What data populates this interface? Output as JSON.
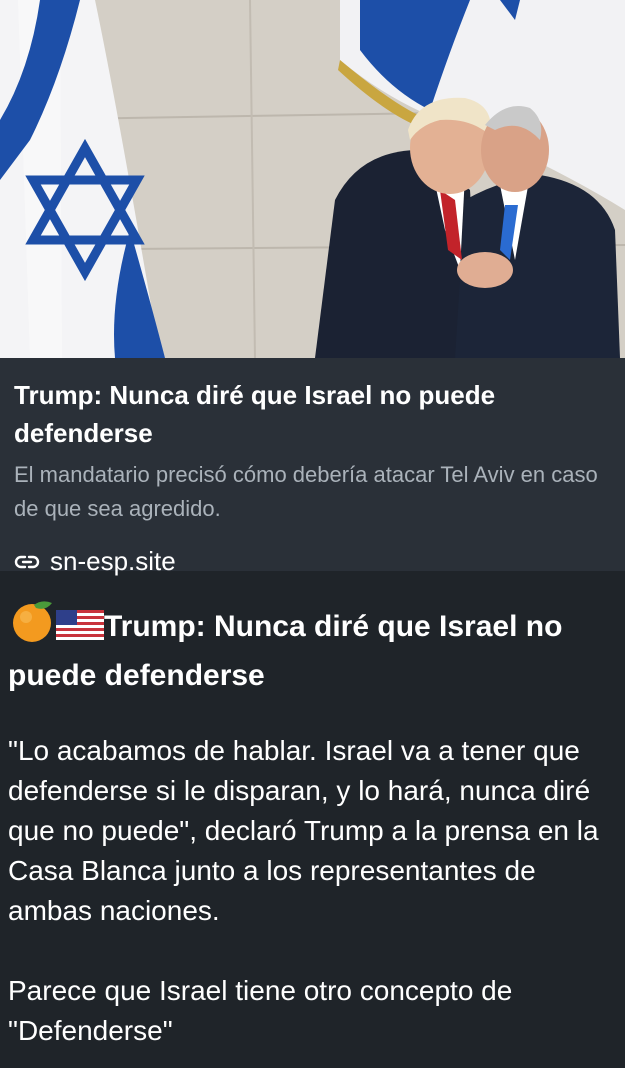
{
  "preview": {
    "title": "Trump: Nunca diré que Israel no puede defenderse",
    "description": "El mandatario precisó cómo debería atacar Tel Aviv en caso de que sea agredido.",
    "domain": "sn-esp.site"
  },
  "message": {
    "heading": "Trump: Nunca diré que Israel no puede defenderse",
    "heading_icons": [
      "orange-emoji",
      "us-flag-emoji"
    ],
    "paragraph1": "\"Lo acabamos de hablar. Israel va a tener que defenderse si le disparan, y lo hará, nunca diré que no puede\", declaró Trump a la prensa en la Casa Blanca junto a los representantes de ambas naciones.",
    "paragraph2": "Parece que Israel tiene otro concepto de \"Defenderse\""
  },
  "colors": {
    "background": "#1f2429",
    "card": "#2a3038",
    "muted_text": "#aab2ba",
    "flag_blue": "#1d4fa8"
  }
}
